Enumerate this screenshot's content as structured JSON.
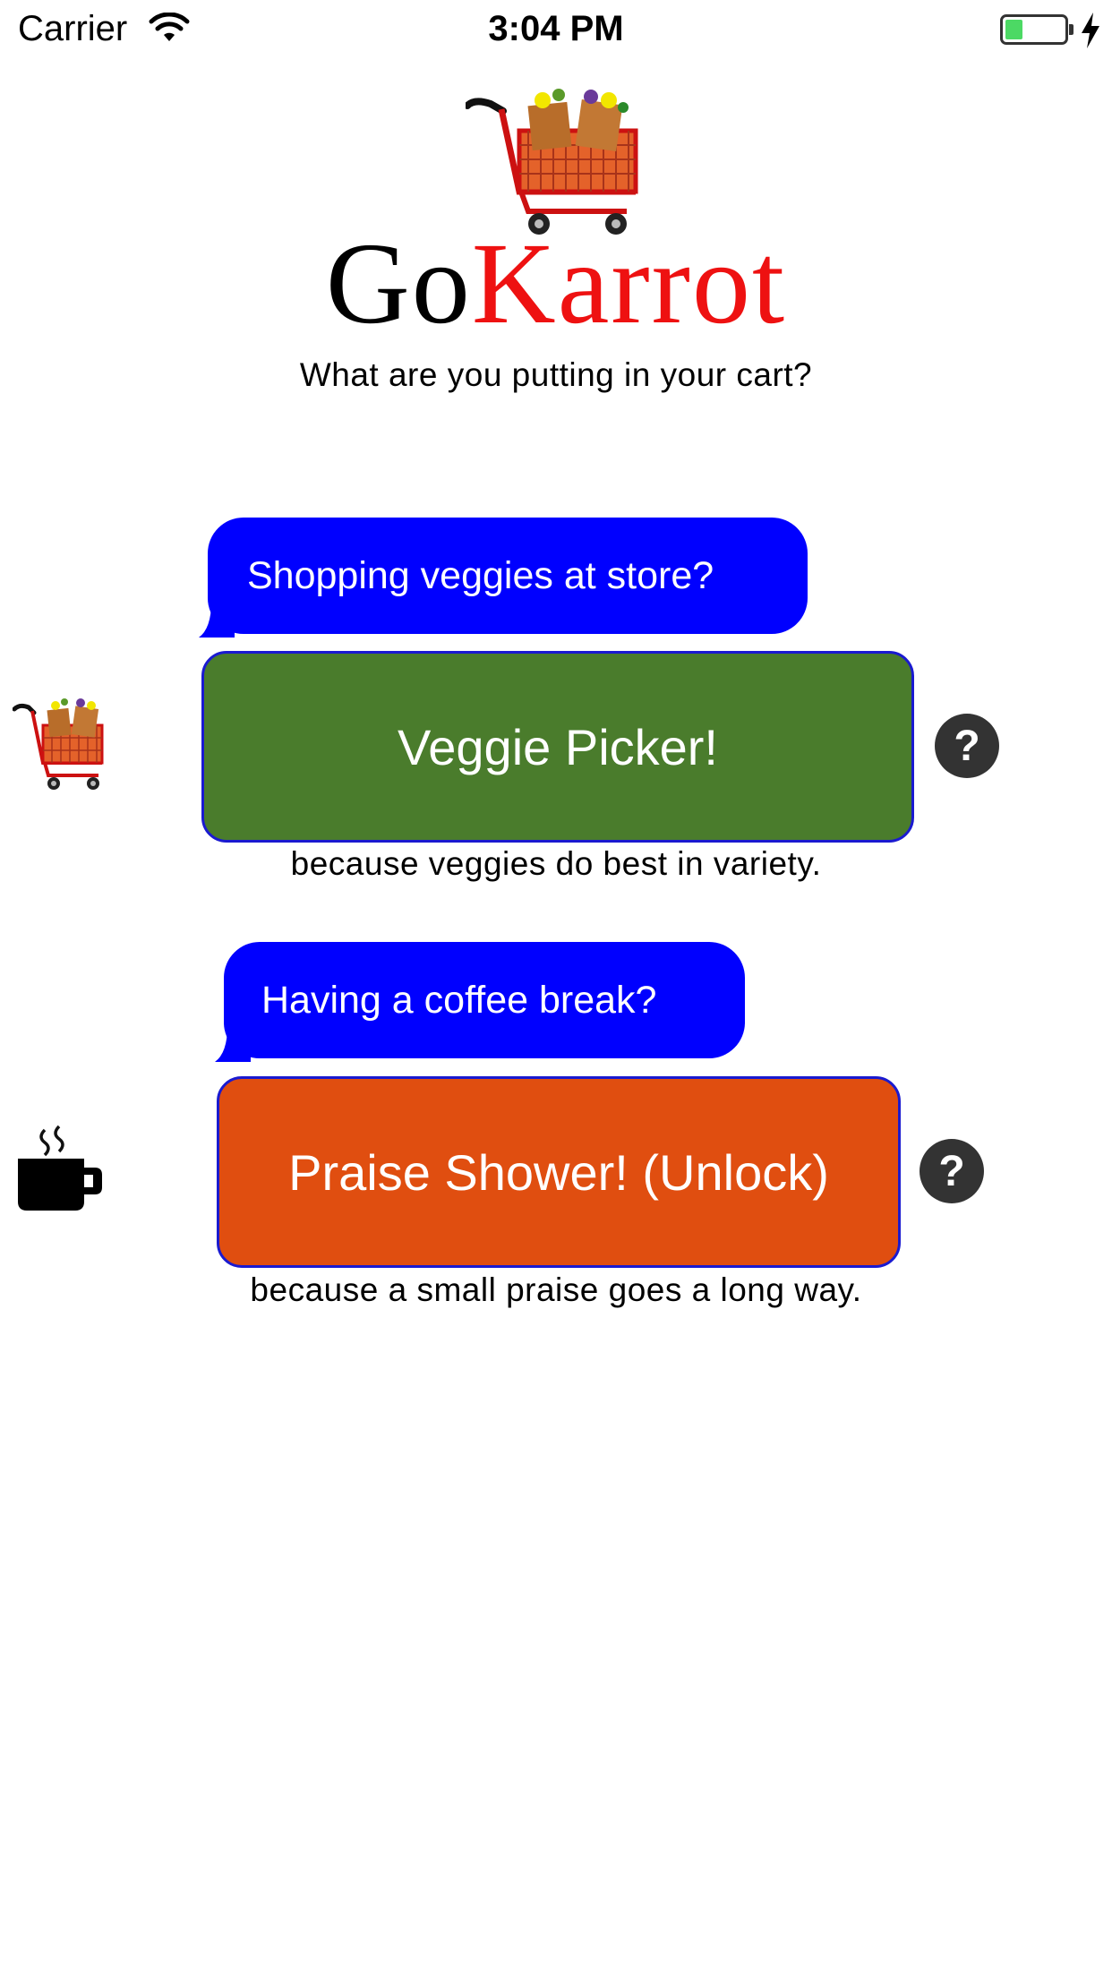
{
  "status_bar": {
    "carrier": "Carrier",
    "time": "3:04 PM",
    "battery_level": 0.3,
    "battery_color": "#4cd964",
    "wifi_icon": "wifi-icon",
    "charging_icon": "bolt-icon"
  },
  "header": {
    "logo_icon": "shopping-cart-icon",
    "logo_go": "Go",
    "logo_karrot": "Karrot",
    "subtitle": "What are you putting in your cart?"
  },
  "colors": {
    "bubble": "#0000ff",
    "veggie_button": "#4a7c2c",
    "praise_button": "#e04e10",
    "help_button": "#333333",
    "logo_accent": "#ee1111"
  },
  "items": [
    {
      "icon": "shopping-cart-icon",
      "prompt": "Shopping veggies at store?",
      "button_label": "Veggie Picker!",
      "help_label": "?",
      "caption": "because veggies do best in variety."
    },
    {
      "icon": "coffee-mug-icon",
      "prompt": "Having a coffee break?",
      "button_label": "Praise Shower! (Unlock)",
      "help_label": "?",
      "caption": "because a small praise goes a long way."
    }
  ]
}
